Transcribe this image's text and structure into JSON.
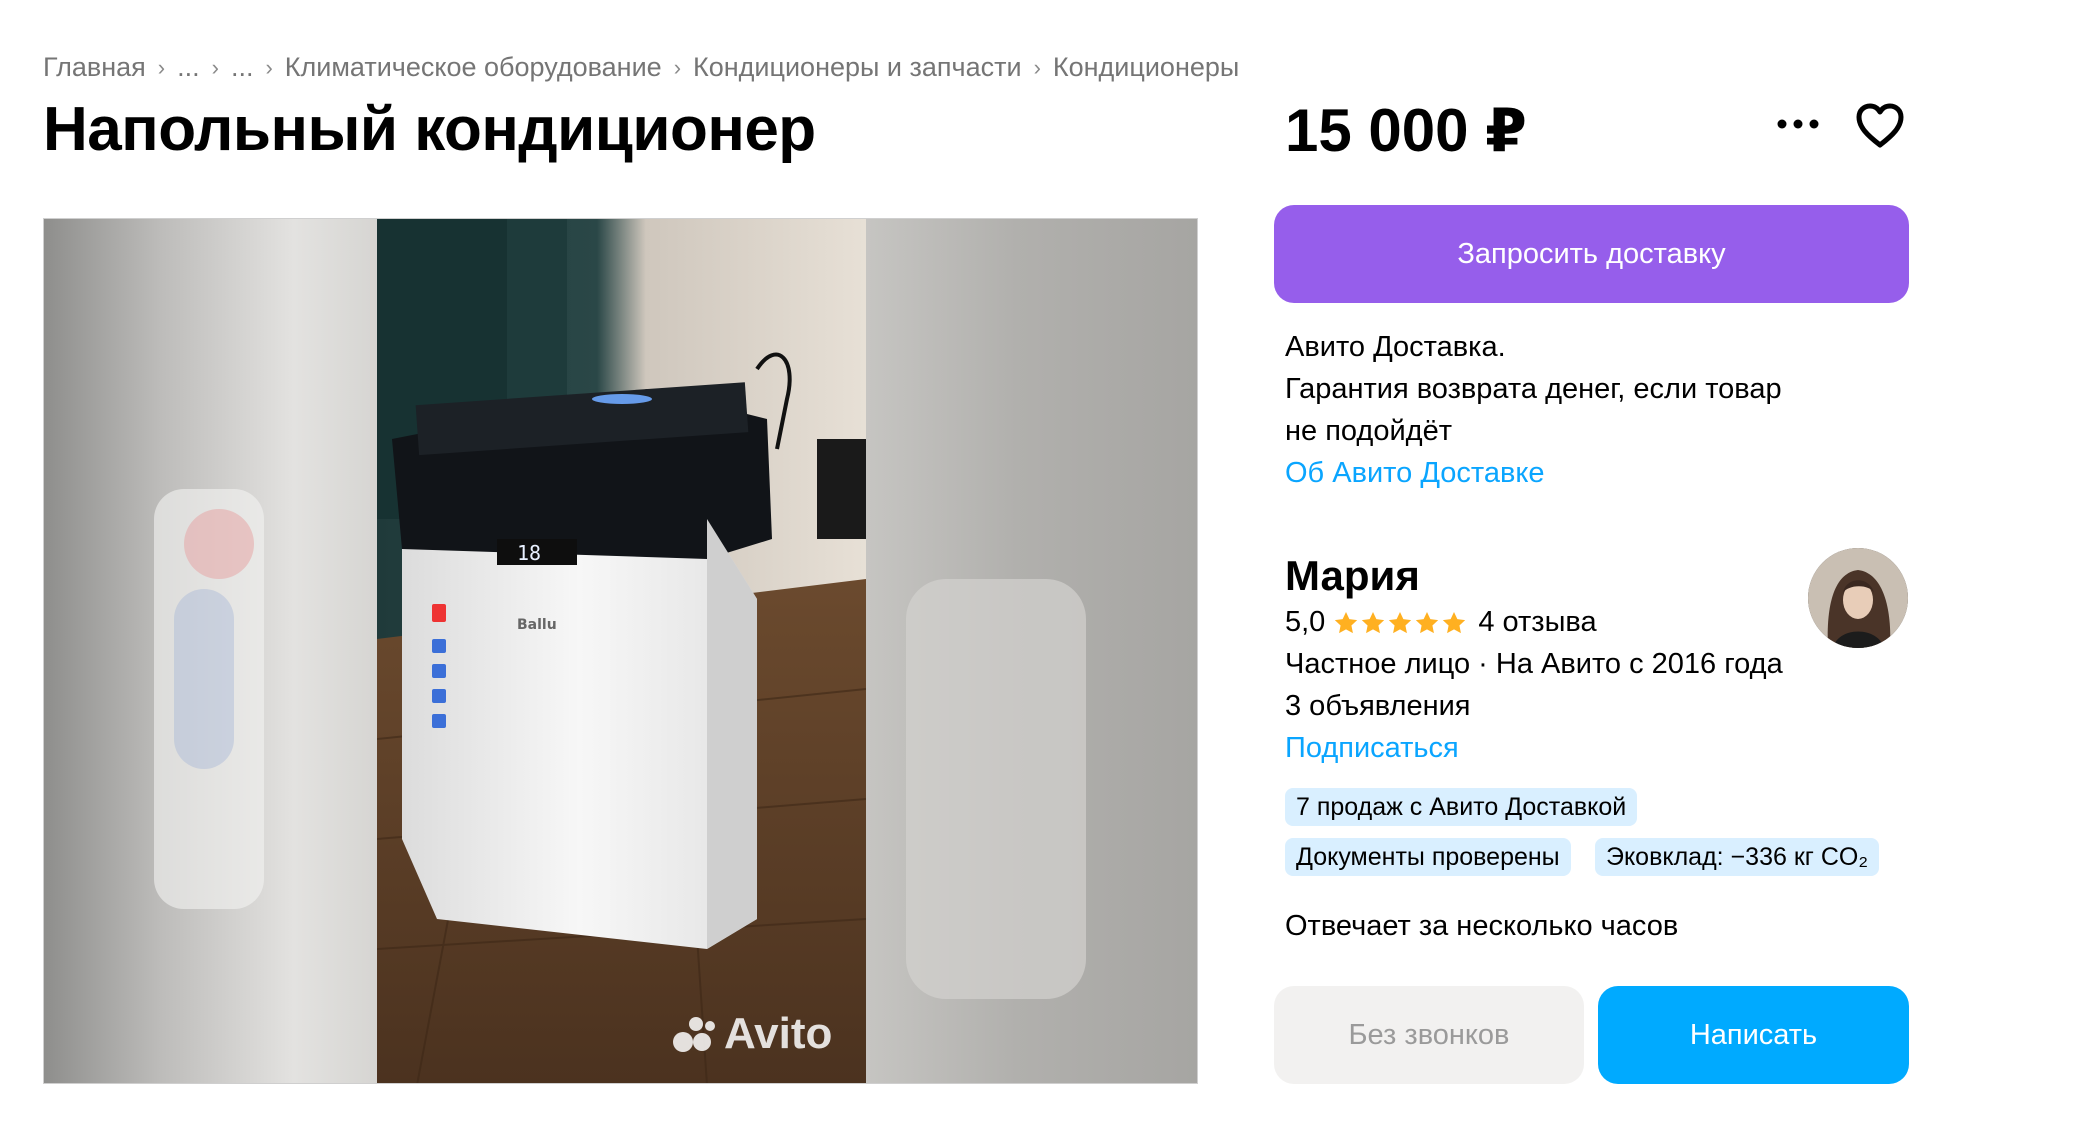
{
  "breadcrumbs": {
    "items": [
      "Главная",
      "...",
      "...",
      "Климатическое оборудование",
      "Кондиционеры и запчасти",
      "Кондиционеры"
    ],
    "separator": "›"
  },
  "listing": {
    "title": "Напольный кондиционер",
    "price": "15 000 ₽",
    "photo_watermark": "Avito",
    "display_reading": "18"
  },
  "actions": {
    "more_icon": "more-horizontal-icon",
    "favorite_icon": "heart-icon"
  },
  "delivery": {
    "button_label": "Запросить доставку",
    "lines": [
      "Авито Доставка.",
      "Гарантия возврата денег, если товар",
      "не подойдёт"
    ],
    "link": "Об Авито Доставке"
  },
  "seller": {
    "name": "Мария",
    "rating": "5,0",
    "stars": 5,
    "reviews": "4 отзыва",
    "type_since": "Частное лицо · На Авито с 2016 года",
    "listings": "3 объявления",
    "subscribe": "Подписаться",
    "badges": [
      "7 продаж с Авито Доставкой",
      "Документы проверены",
      "Эковклад: −336 кг CO₂"
    ],
    "reply_time": "Отвечает за несколько часов"
  },
  "contact": {
    "no_calls_label": "Без звонков",
    "write_label": "Написать"
  },
  "colors": {
    "delivery_button": "#965eeb",
    "write_button": "#00aaff",
    "link": "#0aa5ff",
    "badge_bg": "#d9efff",
    "star": "#ffb021"
  }
}
